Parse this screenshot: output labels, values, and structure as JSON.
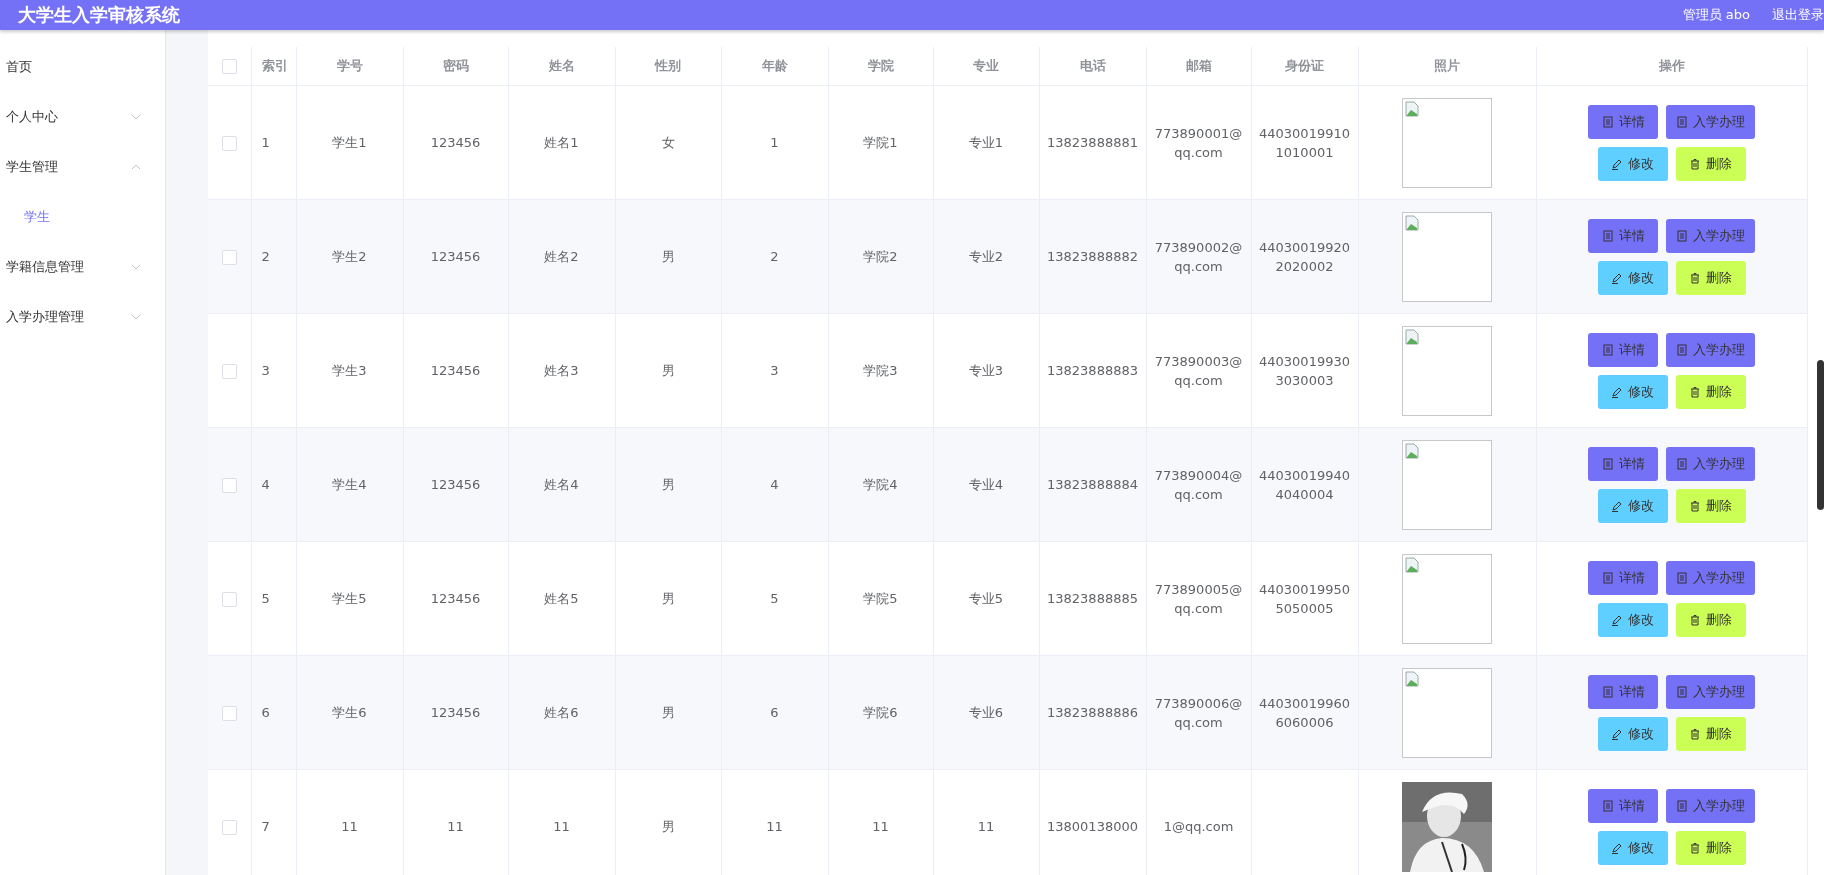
{
  "header": {
    "title": "大学生入学审核系统",
    "user": "管理员 abo",
    "logout": "退出登录"
  },
  "sidebar": {
    "items": [
      {
        "label": "首页",
        "selected": false
      },
      {
        "label": "个人中心",
        "expanded": false,
        "selected": false
      },
      {
        "label": "学生管理",
        "expanded": true,
        "selected": false,
        "children": [
          {
            "label": "学生",
            "selected": true
          }
        ]
      },
      {
        "label": "学籍信息管理",
        "expanded": false,
        "selected": false
      },
      {
        "label": "入学办理管理",
        "expanded": false,
        "selected": false
      }
    ]
  },
  "table": {
    "select_all_checked": false,
    "columns": [
      "索引",
      "学号",
      "密码",
      "姓名",
      "性别",
      "年龄",
      "学院",
      "专业",
      "电话",
      "邮箱",
      "身份证",
      "照片",
      "操作"
    ],
    "rows": [
      {
        "checked": false,
        "cells": [
          "1",
          "学生1",
          "123456",
          "姓名1",
          "女",
          "1",
          "学院1",
          "专业1",
          "13823888881",
          "773890001@qq.com",
          "440300199101010001"
        ],
        "photo": {
          "kind": "broken"
        },
        "actions": [
          {
            "kind": "detail",
            "label": "详情"
          },
          {
            "kind": "admit",
            "label": "入学办理"
          },
          {
            "kind": "edit",
            "label": "修改"
          },
          {
            "kind": "delete",
            "label": "删除"
          }
        ]
      },
      {
        "checked": false,
        "cells": [
          "2",
          "学生2",
          "123456",
          "姓名2",
          "男",
          "2",
          "学院2",
          "专业2",
          "13823888882",
          "773890002@qq.com",
          "440300199202020002"
        ],
        "photo": {
          "kind": "broken"
        },
        "actions": [
          {
            "kind": "detail",
            "label": "详情"
          },
          {
            "kind": "admit",
            "label": "入学办理"
          },
          {
            "kind": "edit",
            "label": "修改"
          },
          {
            "kind": "delete",
            "label": "删除"
          }
        ]
      },
      {
        "checked": false,
        "cells": [
          "3",
          "学生3",
          "123456",
          "姓名3",
          "男",
          "3",
          "学院3",
          "专业3",
          "13823888883",
          "773890003@qq.com",
          "440300199303030003"
        ],
        "photo": {
          "kind": "broken"
        },
        "actions": [
          {
            "kind": "detail",
            "label": "详情"
          },
          {
            "kind": "admit",
            "label": "入学办理"
          },
          {
            "kind": "edit",
            "label": "修改"
          },
          {
            "kind": "delete",
            "label": "删除"
          }
        ]
      },
      {
        "checked": false,
        "cells": [
          "4",
          "学生4",
          "123456",
          "姓名4",
          "男",
          "4",
          "学院4",
          "专业4",
          "13823888884",
          "773890004@qq.com",
          "440300199404040004"
        ],
        "photo": {
          "kind": "broken"
        },
        "actions": [
          {
            "kind": "detail",
            "label": "详情"
          },
          {
            "kind": "admit",
            "label": "入学办理"
          },
          {
            "kind": "edit",
            "label": "修改"
          },
          {
            "kind": "delete",
            "label": "删除"
          }
        ]
      },
      {
        "checked": false,
        "cells": [
          "5",
          "学生5",
          "123456",
          "姓名5",
          "男",
          "5",
          "学院5",
          "专业5",
          "13823888885",
          "773890005@qq.com",
          "440300199505050005"
        ],
        "photo": {
          "kind": "broken"
        },
        "actions": [
          {
            "kind": "detail",
            "label": "详情"
          },
          {
            "kind": "admit",
            "label": "入学办理"
          },
          {
            "kind": "edit",
            "label": "修改"
          },
          {
            "kind": "delete",
            "label": "删除"
          }
        ]
      },
      {
        "checked": false,
        "cells": [
          "6",
          "学生6",
          "123456",
          "姓名6",
          "男",
          "6",
          "学院6",
          "专业6",
          "13823888886",
          "773890006@qq.com",
          "440300199606060006"
        ],
        "photo": {
          "kind": "broken"
        },
        "actions": [
          {
            "kind": "detail",
            "label": "详情"
          },
          {
            "kind": "admit",
            "label": "入学办理"
          },
          {
            "kind": "edit",
            "label": "修改"
          },
          {
            "kind": "delete",
            "label": "删除"
          }
        ]
      },
      {
        "checked": false,
        "cells": [
          "7",
          "11",
          "11",
          "11",
          "男",
          "11",
          "11",
          "11",
          "13800138000",
          "1@qq.com",
          ""
        ],
        "photo": {
          "kind": "picture"
        },
        "actions": [
          {
            "kind": "detail",
            "label": "详情"
          },
          {
            "kind": "admit",
            "label": "入学办理"
          },
          {
            "kind": "edit",
            "label": "修改"
          },
          {
            "kind": "delete",
            "label": "删除"
          }
        ]
      }
    ]
  }
}
